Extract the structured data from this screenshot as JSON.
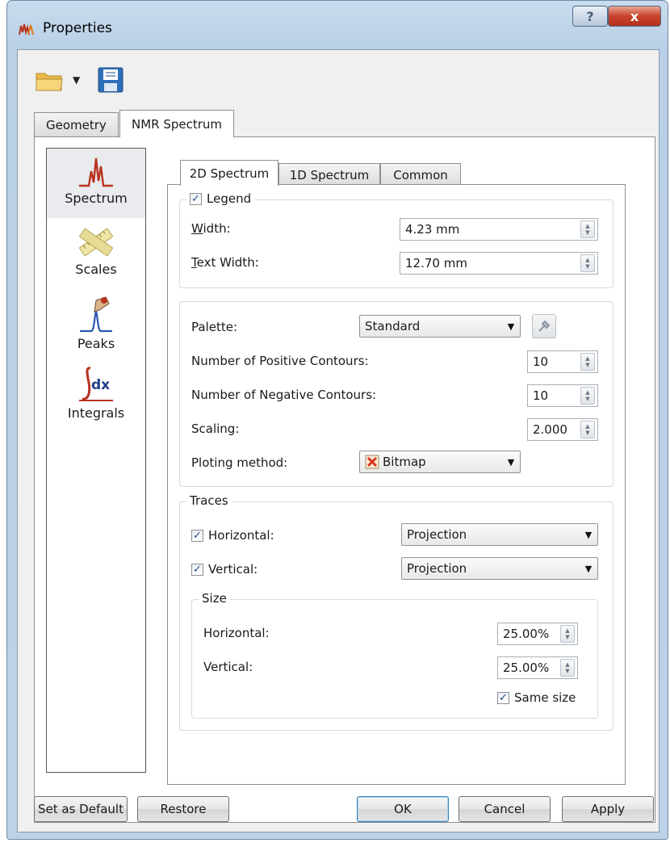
{
  "window": {
    "title": "Properties",
    "help_glyph": "?",
    "close_glyph": "x"
  },
  "tabs": {
    "geometry": "Geometry",
    "nmr_spectrum": "NMR Spectrum"
  },
  "side_nav": [
    {
      "label": "Spectrum",
      "icon": "spectrum-icon"
    },
    {
      "label": "Scales",
      "icon": "ruler-icon"
    },
    {
      "label": "Peaks",
      "icon": "peaks-icon"
    },
    {
      "label": "Integrals",
      "icon": "integral-icon"
    }
  ],
  "inner_tabs": {
    "spectrum_2d": "2D Spectrum",
    "spectrum_1d": "1D Spectrum",
    "common": "Common"
  },
  "legend": {
    "caption": "Legend",
    "checked": true,
    "width_label_first": "W",
    "width_label_rest": "idth:",
    "width_value": "4.23 mm",
    "text_width_label_first": "T",
    "text_width_label_rest": "ext Width:",
    "text_width_value": "12.70 mm"
  },
  "contours": {
    "palette_label": "Palette:",
    "palette_value": "Standard",
    "positive_label": "Number of Positive Contours:",
    "positive_value": "10",
    "negative_label": "Number of Negative Contours:",
    "negative_value": "10",
    "scaling_label": "Scaling:",
    "scaling_value": "2.000",
    "ploting_label": "Ploting method:",
    "ploting_value": "Bitmap"
  },
  "traces": {
    "caption": "Traces",
    "horizontal_label": "Horizontal:",
    "horizontal_checked": true,
    "horizontal_value": "Projection",
    "vertical_label": "Vertical:",
    "vertical_checked": true,
    "vertical_value": "Projection",
    "size": {
      "caption": "Size",
      "horizontal_label": "Horizontal:",
      "horizontal_value": "25.00%",
      "vertical_label": "Vertical:",
      "vertical_value": "25.00%",
      "same_size_label": "Same size",
      "same_size_checked": true
    }
  },
  "buttons": {
    "set_default": "Set as Default",
    "restore": "Restore",
    "ok": "OK",
    "cancel": "Cancel",
    "apply": "Apply"
  },
  "colors": {
    "accent": "#2a4d84",
    "titlebar": "#bcd2e8",
    "close": "#c8432b"
  }
}
